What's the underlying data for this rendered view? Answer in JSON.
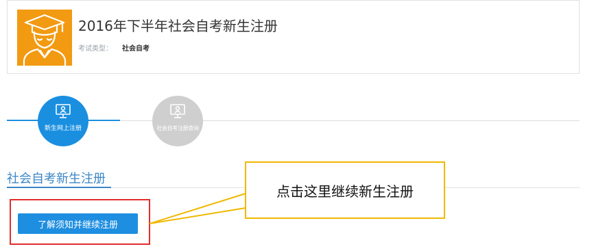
{
  "header": {
    "title": "2016年下半年社会自考新生注册",
    "exam_type_label": "考试类型：",
    "exam_type_value": "社会自考",
    "icon": "graduate-icon",
    "icon_bg": "#f29a12"
  },
  "steps": [
    {
      "label": "新生网上注册",
      "icon": "monitor-user-icon",
      "state": "active"
    },
    {
      "label": "社会自考注册查询",
      "icon": "monitor-user-icon",
      "state": "inactive"
    }
  ],
  "section": {
    "title": "社会自考新生注册"
  },
  "actions": {
    "continue_label": "了解须知并继续注册"
  },
  "annotation": {
    "callout_text": "点击这里继续新生注册"
  },
  "colors": {
    "accent": "#1a8fe0",
    "highlight": "#e12c2c",
    "callout_border": "#f0b800",
    "inactive_step": "#cfcfcf"
  }
}
